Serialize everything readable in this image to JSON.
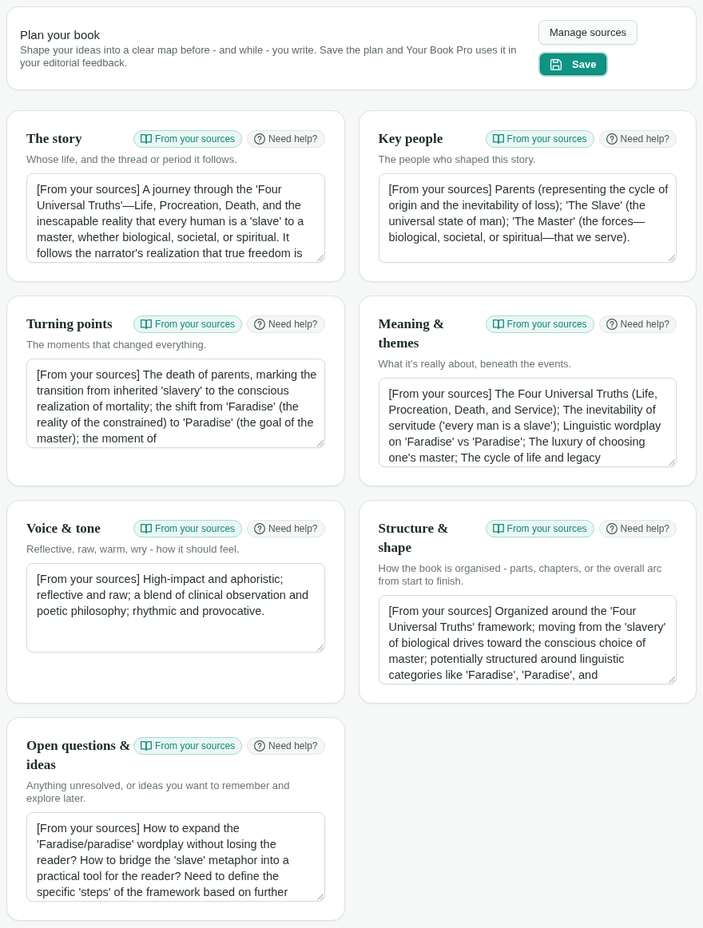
{
  "header": {
    "title": "Plan your book",
    "description": "Shape your ideas into a clear map before - and while - you write. Save the plan and Your Book Pro uses it in your editorial feedback.",
    "buttons": [
      {
        "label": "Manage sources",
        "kind": "secondary"
      },
      {
        "label": "Save",
        "kind": "primary"
      }
    ]
  },
  "sections": [
    {
      "title": "The story",
      "sources_button": "From your sources",
      "help_button": "Need help?",
      "hint": "Whose life, and the thread or period it follows.",
      "value": "[From your sources] A journey through the 'Four Universal Truths'—Life, Procreation, Death, and the inescapable reality that every human is a 'slave' to a master, whether biological, societal, or spiritual. It follows the narrator's realization that true freedom is"
    },
    {
      "title": "Key people",
      "sources_button": "From your sources",
      "help_button": "Need help?",
      "hint": "The people who shaped this story.",
      "value": "[From your sources] Parents (representing the cycle of origin and the inevitability of loss); 'The Slave' (the universal state of man); 'The Master' (the forces—biological, societal, or spiritual—that we serve)."
    },
    {
      "title": "Turning points",
      "sources_button": "From your sources",
      "help_button": "Need help?",
      "hint": "The moments that changed everything.",
      "value": "[From your sources] The death of parents, marking the transition from inherited 'slavery' to the conscious realization of mortality; the shift from 'Faradise' (the reality of the constrained) to 'Paradise' (the goal of the master); the moment of"
    },
    {
      "title": "Meaning & themes",
      "sources_button": "From your sources",
      "help_button": "Need help?",
      "hint": "What it's really about, beneath the events.",
      "value": "[From your sources] The Four Universal Truths (Life, Procreation, Death, and Service); The inevitability of servitude ('every man is a slave'); Linguistic wordplay on 'Faradise' vs 'Paradise'; The luxury of choosing one's master; The cycle of life and legacy"
    },
    {
      "title": "Voice & tone",
      "sources_button": "From your sources",
      "help_button": "Need help?",
      "hint": "Reflective, raw, warm, wry - how it should feel.",
      "value": "[From your sources] High-impact and aphoristic; reflective and raw; a blend of clinical observation and poetic philosophy; rhythmic and provocative."
    },
    {
      "title": "Structure & shape",
      "sources_button": "From your sources",
      "help_button": "Need help?",
      "hint": "How the book is organised - parts, chapters, or the overall arc from start to finish.",
      "value": "[From your sources] Organized around the 'Four Universal Truths' framework; moving from the 'slavery' of biological drives toward the conscious choice of master; potentially structured around linguistic categories like 'Faradise', 'Paradise', and"
    },
    {
      "title": "Open questions & ideas",
      "sources_button": "From your sources",
      "help_button": "Need help?",
      "hint": "Anything unresolved, or ideas you want to remember and explore later.",
      "value": "[From your sources] How to expand the 'Faradise/paradise' wordplay without losing the reader? How to bridge the 'slave' metaphor into a practical tool for the reader? Need to define the specific 'steps' of the framework based on further"
    }
  ]
}
